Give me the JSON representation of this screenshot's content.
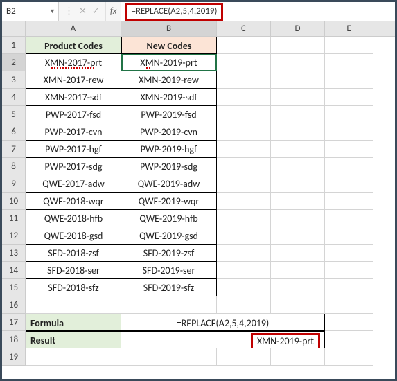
{
  "nameBox": "B2",
  "fxLabel": "fx",
  "formulaBar": "=REPLACE(A2,5,4,2019)",
  "columns": {
    "A": "A",
    "B": "B",
    "C": "C",
    "D": "D",
    "E": "E"
  },
  "headers": {
    "A": "Product Codes",
    "B": "New Codes"
  },
  "rows": [
    {
      "a": "XMN-2017-prt",
      "b": "XMN-2019-prt"
    },
    {
      "a": "XMN-2017-rew",
      "b": "XMN-2019-rew"
    },
    {
      "a": "XMN-2017-sdf",
      "b": "XMN-2019-sdf"
    },
    {
      "a": "PWP-2017-fsd",
      "b": "PWP-2019-fsd"
    },
    {
      "a": "PWP-2017-cvn",
      "b": "PWP-2019-cvn"
    },
    {
      "a": "PWP-2017-hgf",
      "b": "PWP-2019-hgf"
    },
    {
      "a": "PWP-2017-sdg",
      "b": "PWP-2019-sdg"
    },
    {
      "a": "QWE-2017-adw",
      "b": "QWE-2019-adw"
    },
    {
      "a": "QWE-2018-wqr",
      "b": "QWE-2019-wqr"
    },
    {
      "a": "QWE-2018-hfb",
      "b": "QWE-2019-hfb"
    },
    {
      "a": "QWE-2018-gsd",
      "b": "QWE-2019-gsd"
    },
    {
      "a": "SFD-2018-zsf",
      "b": "SFD-2019-zsf"
    },
    {
      "a": "SFD-2018-ser",
      "b": "SFD-2019-ser"
    },
    {
      "a": "SFD-2018-sfz",
      "b": "SFD-2019-sfz"
    }
  ],
  "footer": {
    "formulaLabel": "Formula",
    "formulaValue": "=REPLACE(A2,5,4,2019)",
    "resultLabel": "Result",
    "resultValue": "XMN-2019-prt"
  },
  "rowNums": [
    "1",
    "2",
    "3",
    "4",
    "5",
    "6",
    "7",
    "8",
    "9",
    "10",
    "11",
    "12",
    "13",
    "14",
    "15",
    "16",
    "17",
    "18",
    "19"
  ]
}
